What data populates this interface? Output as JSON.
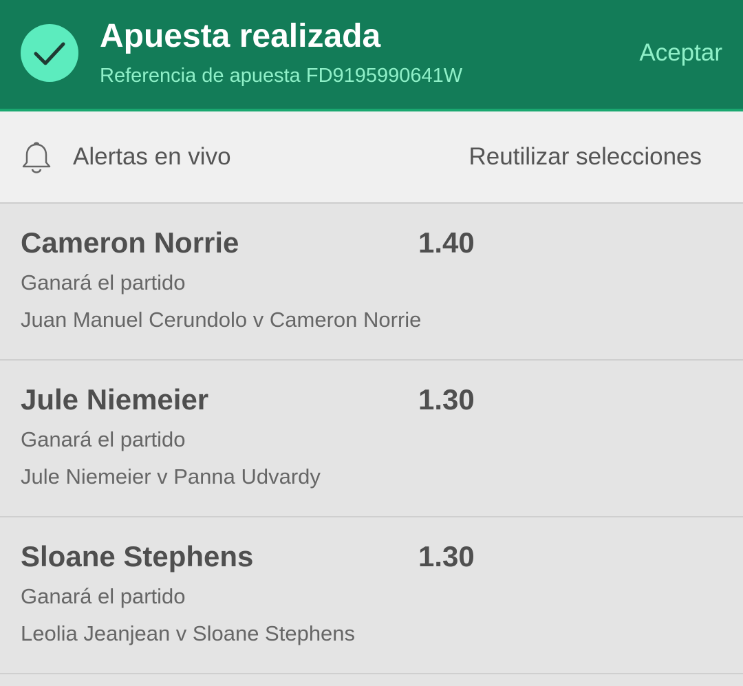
{
  "header": {
    "title": "Apuesta realizada",
    "reference": "Referencia de apuesta FD9195990641W",
    "accept_label": "Aceptar",
    "icon": "check-icon",
    "background": "#137c58",
    "accent": "#5cecbe"
  },
  "toolbar": {
    "alerts_icon": "bell-icon",
    "alerts_label": "Alertas en vivo",
    "reuse_label": "Reutilizar selecciones"
  },
  "selections": [
    {
      "name": "Cameron Norrie",
      "odds": "1.40",
      "market": "Ganará el partido",
      "event": "Juan Manuel Cerundolo v Cameron Norrie"
    },
    {
      "name": "Jule Niemeier",
      "odds": "1.30",
      "market": "Ganará el partido",
      "event": "Jule Niemeier v Panna Udvardy"
    },
    {
      "name": "Sloane Stephens",
      "odds": "1.30",
      "market": "Ganará el partido",
      "event": "Leolia Jeanjean v Sloane Stephens"
    }
  ]
}
